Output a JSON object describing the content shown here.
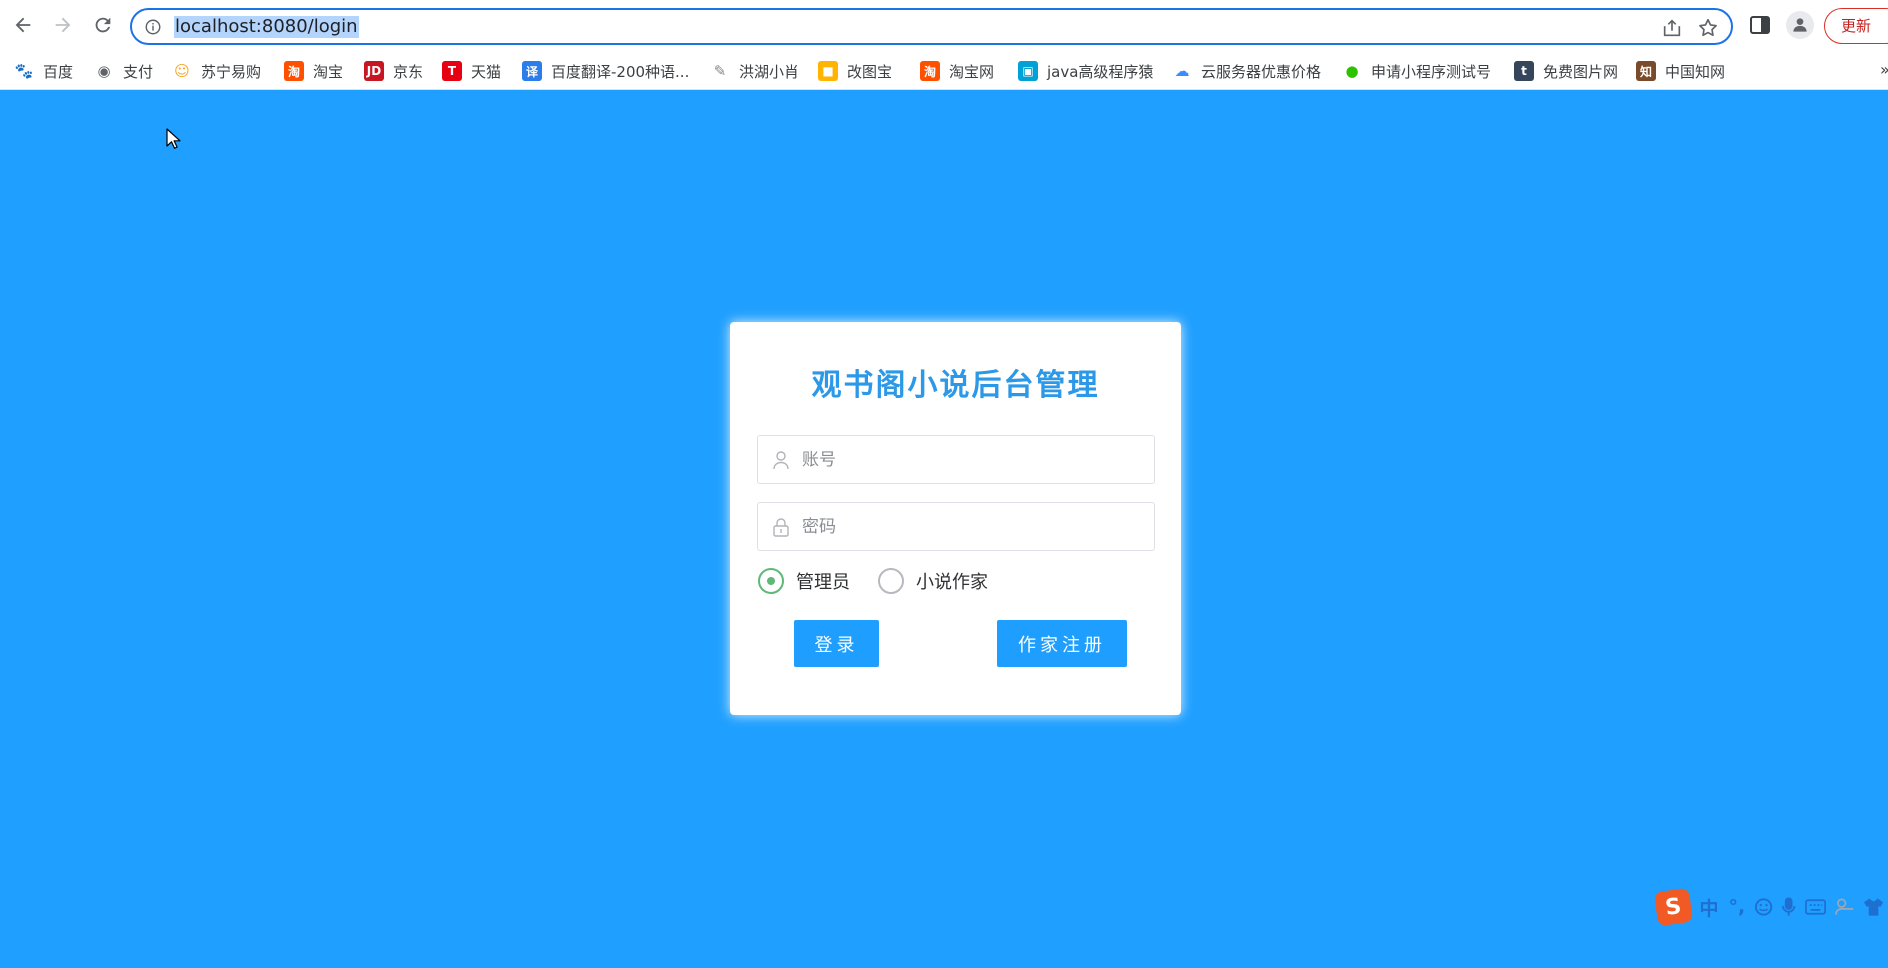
{
  "browser": {
    "url": "localhost:8080/login",
    "update_label": "更新"
  },
  "bookmarks": [
    {
      "label": "百度",
      "icon": "baidu-paw-icon",
      "color": "#2932e1"
    },
    {
      "label": "支付",
      "icon": "globe-icon",
      "color": "#5f6368"
    },
    {
      "label": "苏宁易购",
      "icon": "suning-lion-icon",
      "color": "#f5a623"
    },
    {
      "label": "淘宝",
      "icon": "taobao-icon",
      "color": "#ff5000"
    },
    {
      "label": "京东",
      "icon": "jd-icon",
      "color": "#c81623"
    },
    {
      "label": "天猫",
      "icon": "tmall-icon",
      "color": "#e60012"
    },
    {
      "label": "百度翻译-200种语...",
      "icon": "translate-icon",
      "color": "#2b7de9"
    },
    {
      "label": "洪湖小肖",
      "icon": "feather-icon",
      "color": "#888888"
    },
    {
      "label": "改图宝",
      "icon": "gaitubao-icon",
      "color": "#ffb400"
    },
    {
      "label": "淘宝网",
      "icon": "taobao-icon",
      "color": "#ff5000"
    },
    {
      "label": "java高级程序猿",
      "icon": "bilibili-icon",
      "color": "#00a1d6"
    },
    {
      "label": "云服务器优惠价格",
      "icon": "cloud-icon",
      "color": "#3c8cff"
    },
    {
      "label": "申请小程序测试号",
      "icon": "wechat-icon",
      "color": "#2dc100"
    },
    {
      "label": "免费图片网",
      "icon": "tumblr-icon",
      "color": "#35465c"
    },
    {
      "label": "中国知网",
      "icon": "cnki-icon",
      "color": "#7a4b2a"
    }
  ],
  "login": {
    "title": "观书阁小说后台管理",
    "account_placeholder": "账号",
    "password_placeholder": "密码",
    "roles": [
      {
        "label": "管理员",
        "selected": true
      },
      {
        "label": "小说作家",
        "selected": false
      }
    ],
    "login_button": "登录",
    "register_button": "作家注册"
  },
  "ime": {
    "logo": "S",
    "mode": "中",
    "punct": "°,"
  },
  "colors": {
    "page_bg": "#1f9fff",
    "title": "#2b98e8",
    "button": "#1e9fff",
    "radio_selected": "#5fb878"
  }
}
